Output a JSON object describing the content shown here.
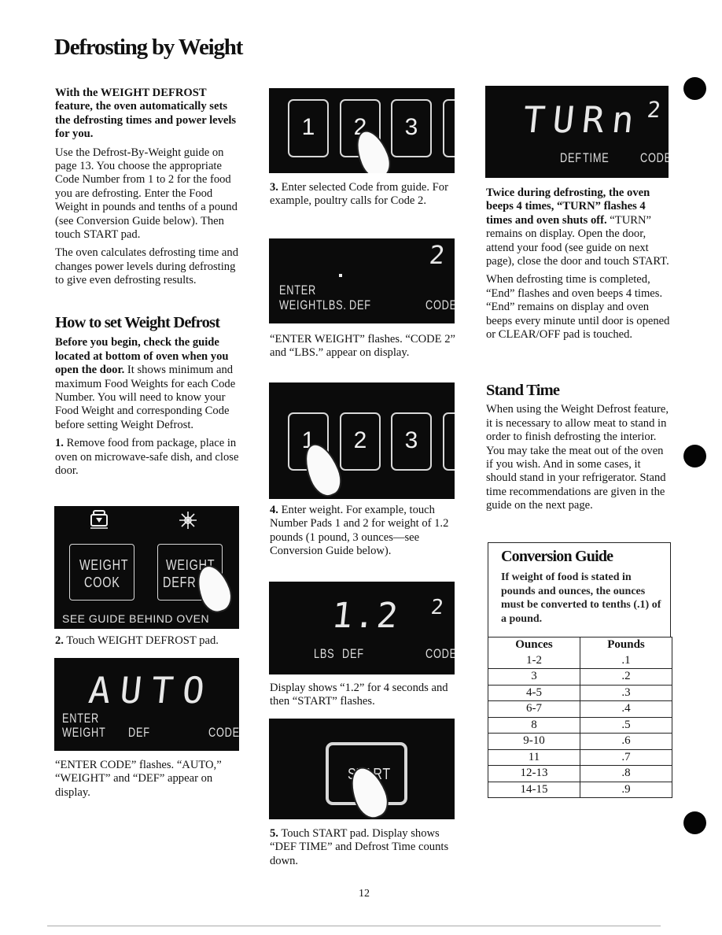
{
  "page": {
    "title": "Defrosting by Weight",
    "page_number": "12"
  },
  "left": {
    "intro_bold": "With the WEIGHT DEFROST feature, the oven automatically sets the defrosting times and power levels for you.",
    "intro_p1": "Use the Defrost-By-Weight guide on page 13. You choose the appropriate Code Number from 1 to 2 for the food you are defrosting. Enter the Food Weight in pounds and tenths of a pound (see Conversion Guide below). Then touch START pad.",
    "intro_p2": "The oven calculates defrosting time and changes power levels during defrosting to give even defrosting results.",
    "howto_heading": "How to set Weight Defrost",
    "howto_bold": "Before you begin, check the guide located at bottom of oven when you open the door.",
    "howto_text": " It shows minimum and maximum Food Weights for each Code Number. You will need to know your Food Weight and corresponding Code before setting Weight Defrost.",
    "step1_num": "1.",
    "step1_text": " Remove food from package, place in oven on microwave-safe dish, and close door.",
    "panel1": {
      "pad_left_line1": "WEIGHT",
      "pad_left_line2": "COOK",
      "pad_right_line1": "WEIGHT",
      "pad_right_line2": "DEFR",
      "footer": "SEE GUIDE BEHIND OVEN",
      "icon_left": "weight-cook-icon",
      "icon_right": "snowflake-icon"
    },
    "step2_num": "2.",
    "step2_text": " Touch WEIGHT DEFROST pad.",
    "display1": {
      "main": "AUTO",
      "label_enter": "ENTER",
      "label_weight": "WEIGHT",
      "label_def": "DEF",
      "label_code": "CODE"
    },
    "display1_caption": "“ENTER CODE” flashes. “AUTO,” “WEIGHT” and “DEF” appear on display."
  },
  "middle": {
    "keypad1": {
      "keys": [
        "1",
        "2",
        "3"
      ]
    },
    "step3_num": "3.",
    "step3_text": " Enter selected Code from guide. For example, poultry calls for Code 2.",
    "display2": {
      "code": "2",
      "label_enter": "ENTER",
      "label_weight": "WEIGHT",
      "label_lbs": "LBS.",
      "label_def": "DEF",
      "label_code": "CODE"
    },
    "display2_caption": "“ENTER WEIGHT” flashes. “CODE 2” and “LBS.” appear on display.",
    "keypad2": {
      "keys": [
        "1",
        "2",
        "3"
      ]
    },
    "step4_num": "4.",
    "step4_text": " Enter weight. For example, touch Number Pads 1 and 2 for weight of 1.2 pounds (1 pound, 3 ounces—see Conversion Guide below).",
    "display3": {
      "main": "1.2",
      "code": "2",
      "label_lbs": "LBS",
      "label_def": "DEF",
      "label_code": "CODE"
    },
    "display3_caption": "Display shows “1.2” for 4 seconds and then “START” flashes.",
    "start_pad_label": "START",
    "step5_num": "5.",
    "step5_text": " Touch START pad. Display shows “DEF TIME” and Defrost Time counts down."
  },
  "right": {
    "display4": {
      "main": "TURn",
      "code": "2",
      "label_def": "DEF",
      "label_time": "TIME",
      "label_code": "CODE"
    },
    "turn_bold": "Twice during defrosting, the oven beeps 4 times, “TURN” flashes 4 times and oven shuts off.",
    "turn_text": " “TURN” remains on display. Open the door, attend your food (see guide on next page), close the door and touch START.",
    "end_text": "When defrosting time is completed, “End” flashes and oven beeps 4 times. “End” remains on display and oven beeps every minute until door is opened or CLEAR/OFF pad is touched.",
    "stand_heading": "Stand Time",
    "stand_text": "When using the Weight Defrost feature, it is necessary to allow meat to stand in order to finish defrosting the interior. You may take the meat out of the oven if you wish. And in some cases, it should stand in your refrigerator. Stand time recommendations are given in the guide on the next page.",
    "conversion": {
      "heading": "Conversion Guide",
      "description": "If weight of food is stated in pounds and ounces, the ounces must be converted to tenths (.1) of a pound.",
      "col_ounces": "Ounces",
      "col_pounds": "Pounds",
      "rows": [
        {
          "ounces": "1-2",
          "pounds": ".1"
        },
        {
          "ounces": "3",
          "pounds": ".2"
        },
        {
          "ounces": "4-5",
          "pounds": ".3"
        },
        {
          "ounces": "6-7",
          "pounds": ".4"
        },
        {
          "ounces": "8",
          "pounds": ".5"
        },
        {
          "ounces": "9-10",
          "pounds": ".6"
        },
        {
          "ounces": "11",
          "pounds": ".7"
        },
        {
          "ounces": "12-13",
          "pounds": ".8"
        },
        {
          "ounces": "14-15",
          "pounds": ".9"
        }
      ]
    }
  },
  "binder_holes": 3
}
